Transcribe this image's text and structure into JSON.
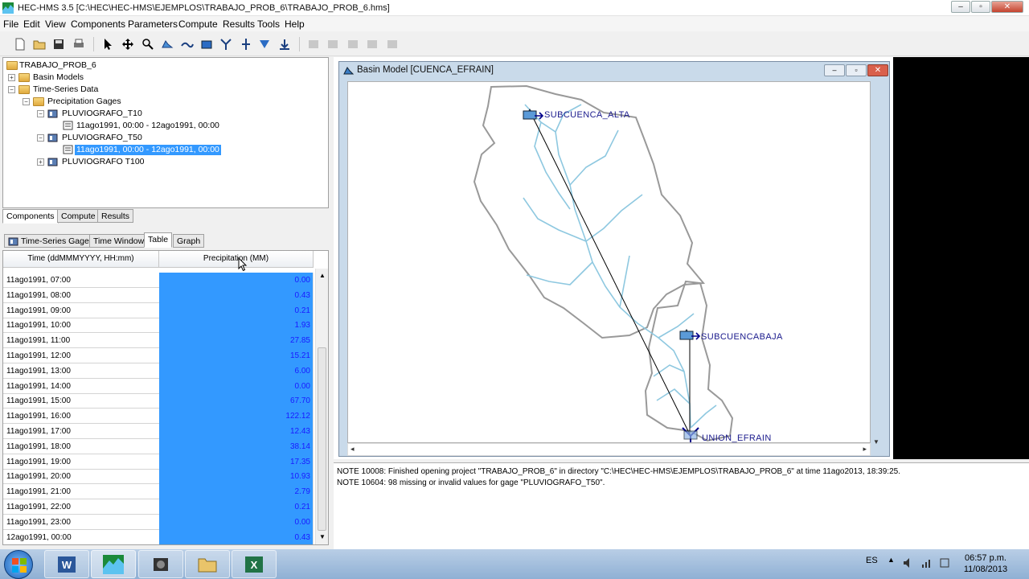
{
  "window": {
    "title": "HEC-HMS 3.5 [C:\\HEC\\HEC-HMS\\EJEMPLOS\\TRABAJO_PROB_6\\TRABAJO_PROB_6.hms]"
  },
  "menu": [
    "File",
    "Edit",
    "View",
    "Components",
    "Parameters",
    "Compute",
    "Results",
    "Tools",
    "Help"
  ],
  "tree": {
    "root": "TRABAJO_PROB_6",
    "basin_models": "Basin Models",
    "ts_data": "Time-Series Data",
    "precip_gages": "Precipitation Gages",
    "gage1": "PLUVIOGRAFO_T10",
    "gage1_window": "11ago1991, 00:00 - 12ago1991, 00:00",
    "gage2": "PLUVIOGRAFO_T50",
    "gage2_window": "11ago1991, 00:00 - 12ago1991, 00:00",
    "gage3": "PLUVIOGRAFO T100"
  },
  "panel_tabs": [
    "Components",
    "Compute",
    "Results"
  ],
  "comp_tabs": [
    "Time-Series Gage",
    "Time Window",
    "Table",
    "Graph"
  ],
  "table": {
    "col_time": "Time (ddMMMYYYY, HH:mm)",
    "col_precip": "Precipitation (MM)",
    "rows": [
      [
        "11ago1991, 07:00",
        "0.00"
      ],
      [
        "11ago1991, 08:00",
        "0.43"
      ],
      [
        "11ago1991, 09:00",
        "0.21"
      ],
      [
        "11ago1991, 10:00",
        "1.93"
      ],
      [
        "11ago1991, 11:00",
        "27.85"
      ],
      [
        "11ago1991, 12:00",
        "15.21"
      ],
      [
        "11ago1991, 13:00",
        "6.00"
      ],
      [
        "11ago1991, 14:00",
        "0.00"
      ],
      [
        "11ago1991, 15:00",
        "67.70"
      ],
      [
        "11ago1991, 16:00",
        "122.12"
      ],
      [
        "11ago1991, 17:00",
        "12.43"
      ],
      [
        "11ago1991, 18:00",
        "38.14"
      ],
      [
        "11ago1991, 19:00",
        "17.35"
      ],
      [
        "11ago1991, 20:00",
        "10.93"
      ],
      [
        "11ago1991, 21:00",
        "2.79"
      ],
      [
        "11ago1991, 22:00",
        "0.21"
      ],
      [
        "11ago1991, 23:00",
        "0.00"
      ],
      [
        "12ago1991, 00:00",
        "0.43"
      ]
    ]
  },
  "basin": {
    "title": "Basin Model [CUENCA_EFRAIN]",
    "subcuenca_alta": "SUBCUENCA_ALTA",
    "subcuenca_baja": "SUBCUENCABAJA",
    "union": "UNION_EFRAIN",
    "boundary_color": "#999999",
    "river_color": "#8ec8e0"
  },
  "messages": [
    "NOTE 10008:  Finished opening project \"TRABAJO_PROB_6\" in directory \"C:\\HEC\\HEC-HMS\\EJEMPLOS\\TRABAJO_PROB_6\" at time 11ago2013, 18:39:25.",
    "NOTE 10604:  98 missing or invalid values for gage \"PLUVIOGRAFO_T50\"."
  ],
  "taskbar": {
    "lang": "ES",
    "time": "06:57 p.m.",
    "date": "11/08/2013"
  },
  "colors": {
    "selection": "#3399ff",
    "value_text": "#1a1aff",
    "label_text": "#1a1a8c"
  }
}
